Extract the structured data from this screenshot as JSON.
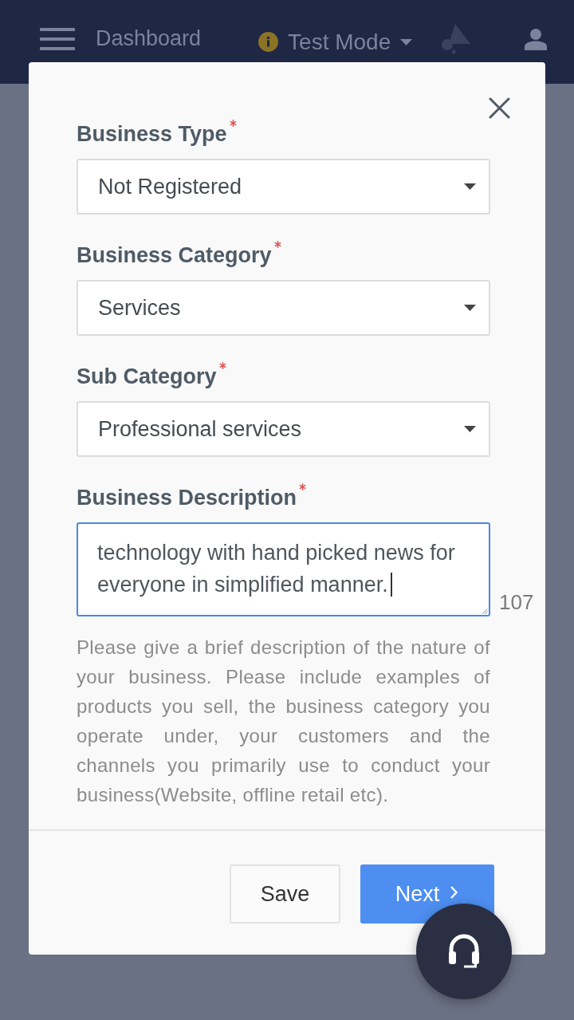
{
  "header": {
    "title": "Dashboard",
    "mode": {
      "label": "Test Mode"
    }
  },
  "dialog": {
    "fields": [
      {
        "kind": "select",
        "label": "Business Type",
        "required": true,
        "value": "Not Registered"
      },
      {
        "kind": "select",
        "label": "Business Category",
        "required": true,
        "value": "Services"
      },
      {
        "kind": "select",
        "label": "Sub Category",
        "required": true,
        "value": "Professional services"
      },
      {
        "kind": "textarea",
        "label": "Business Description",
        "required": true,
        "focused": true,
        "value": "technology with hand picked news for everyone in simplified manner.",
        "counter": "107"
      }
    ],
    "help_text": "Please give a brief description of the nature of your business. Please include examples of products you sell, the business category you operate under, your customers and the channels you primarily use to conduct your business(Website, offline retail etc).",
    "buttons": [
      {
        "kind": "secondary",
        "label": "Save"
      },
      {
        "kind": "primary",
        "label": "Next",
        "arrow": true
      }
    ]
  }
}
